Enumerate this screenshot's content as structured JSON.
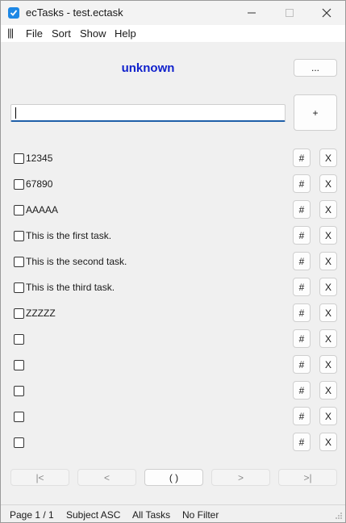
{
  "window": {
    "title": "ecTasks - test.ectask"
  },
  "menu": {
    "handle": "|||",
    "items": [
      "File",
      "Sort",
      "Show",
      "Help"
    ]
  },
  "header": {
    "status_title": "unknown",
    "more_button": "...",
    "add_button": "+",
    "input_value": ""
  },
  "tasks": [
    {
      "label": "12345",
      "checked": false,
      "hash": "#",
      "delete": "X"
    },
    {
      "label": "67890",
      "checked": false,
      "hash": "#",
      "delete": "X"
    },
    {
      "label": "AAAAA",
      "checked": false,
      "hash": "#",
      "delete": "X"
    },
    {
      "label": "This is the first task.",
      "checked": false,
      "hash": "#",
      "delete": "X"
    },
    {
      "label": "This is the second task.",
      "checked": false,
      "hash": "#",
      "delete": "X"
    },
    {
      "label": "This is the third task.",
      "checked": false,
      "hash": "#",
      "delete": "X"
    },
    {
      "label": "ZZZZZ",
      "checked": false,
      "hash": "#",
      "delete": "X"
    },
    {
      "label": "",
      "checked": false,
      "hash": "#",
      "delete": "X"
    },
    {
      "label": "",
      "checked": false,
      "hash": "#",
      "delete": "X"
    },
    {
      "label": "",
      "checked": false,
      "hash": "#",
      "delete": "X"
    },
    {
      "label": "",
      "checked": false,
      "hash": "#",
      "delete": "X"
    },
    {
      "label": "",
      "checked": false,
      "hash": "#",
      "delete": "X"
    }
  ],
  "pager": {
    "first": "|<",
    "prev": "<",
    "current": "(  )",
    "next": ">",
    "last": ">|"
  },
  "status": {
    "page": "Page 1 / 1",
    "sort": "Subject ASC",
    "show": "All Tasks",
    "filter": "No Filter"
  },
  "colors": {
    "accent": "#1122cc",
    "input_focus": "#1f5fa8",
    "app_icon": "#1e88e5"
  }
}
